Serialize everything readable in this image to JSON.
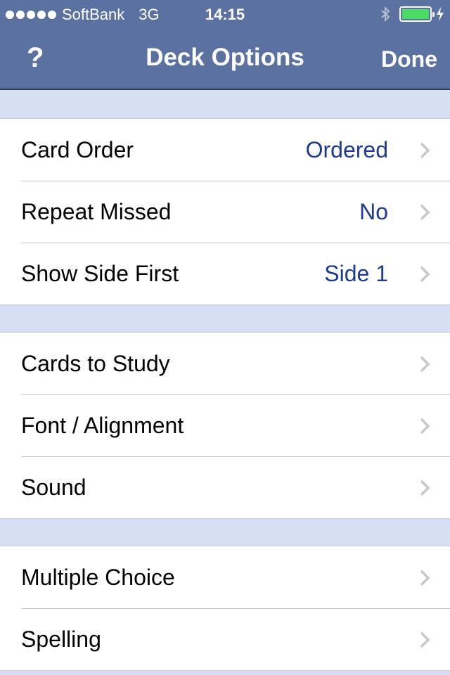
{
  "status_bar": {
    "carrier": "SoftBank",
    "network": "3G",
    "time": "14:15",
    "signal_dots": 5,
    "battery_color": "#4cd964",
    "icons": [
      "bluetooth-icon",
      "battery-icon",
      "charging-bolt-icon"
    ]
  },
  "nav": {
    "help_label": "?",
    "title": "Deck Options",
    "done_label": "Done",
    "bar_color": "#5b71a0"
  },
  "groups": [
    {
      "rows": [
        {
          "label": "Card Order",
          "value": "Ordered"
        },
        {
          "label": "Repeat Missed",
          "value": "No"
        },
        {
          "label": "Show Side First",
          "value": "Side 1"
        }
      ]
    },
    {
      "rows": [
        {
          "label": "Cards to Study"
        },
        {
          "label": "Font / Alignment"
        },
        {
          "label": "Sound"
        }
      ]
    },
    {
      "rows": [
        {
          "label": "Multiple Choice"
        },
        {
          "label": "Spelling"
        }
      ]
    }
  ],
  "colors": {
    "value_text": "#1f3a8a",
    "group_background": "#d6def3",
    "chevron": "#c7c7cc"
  }
}
